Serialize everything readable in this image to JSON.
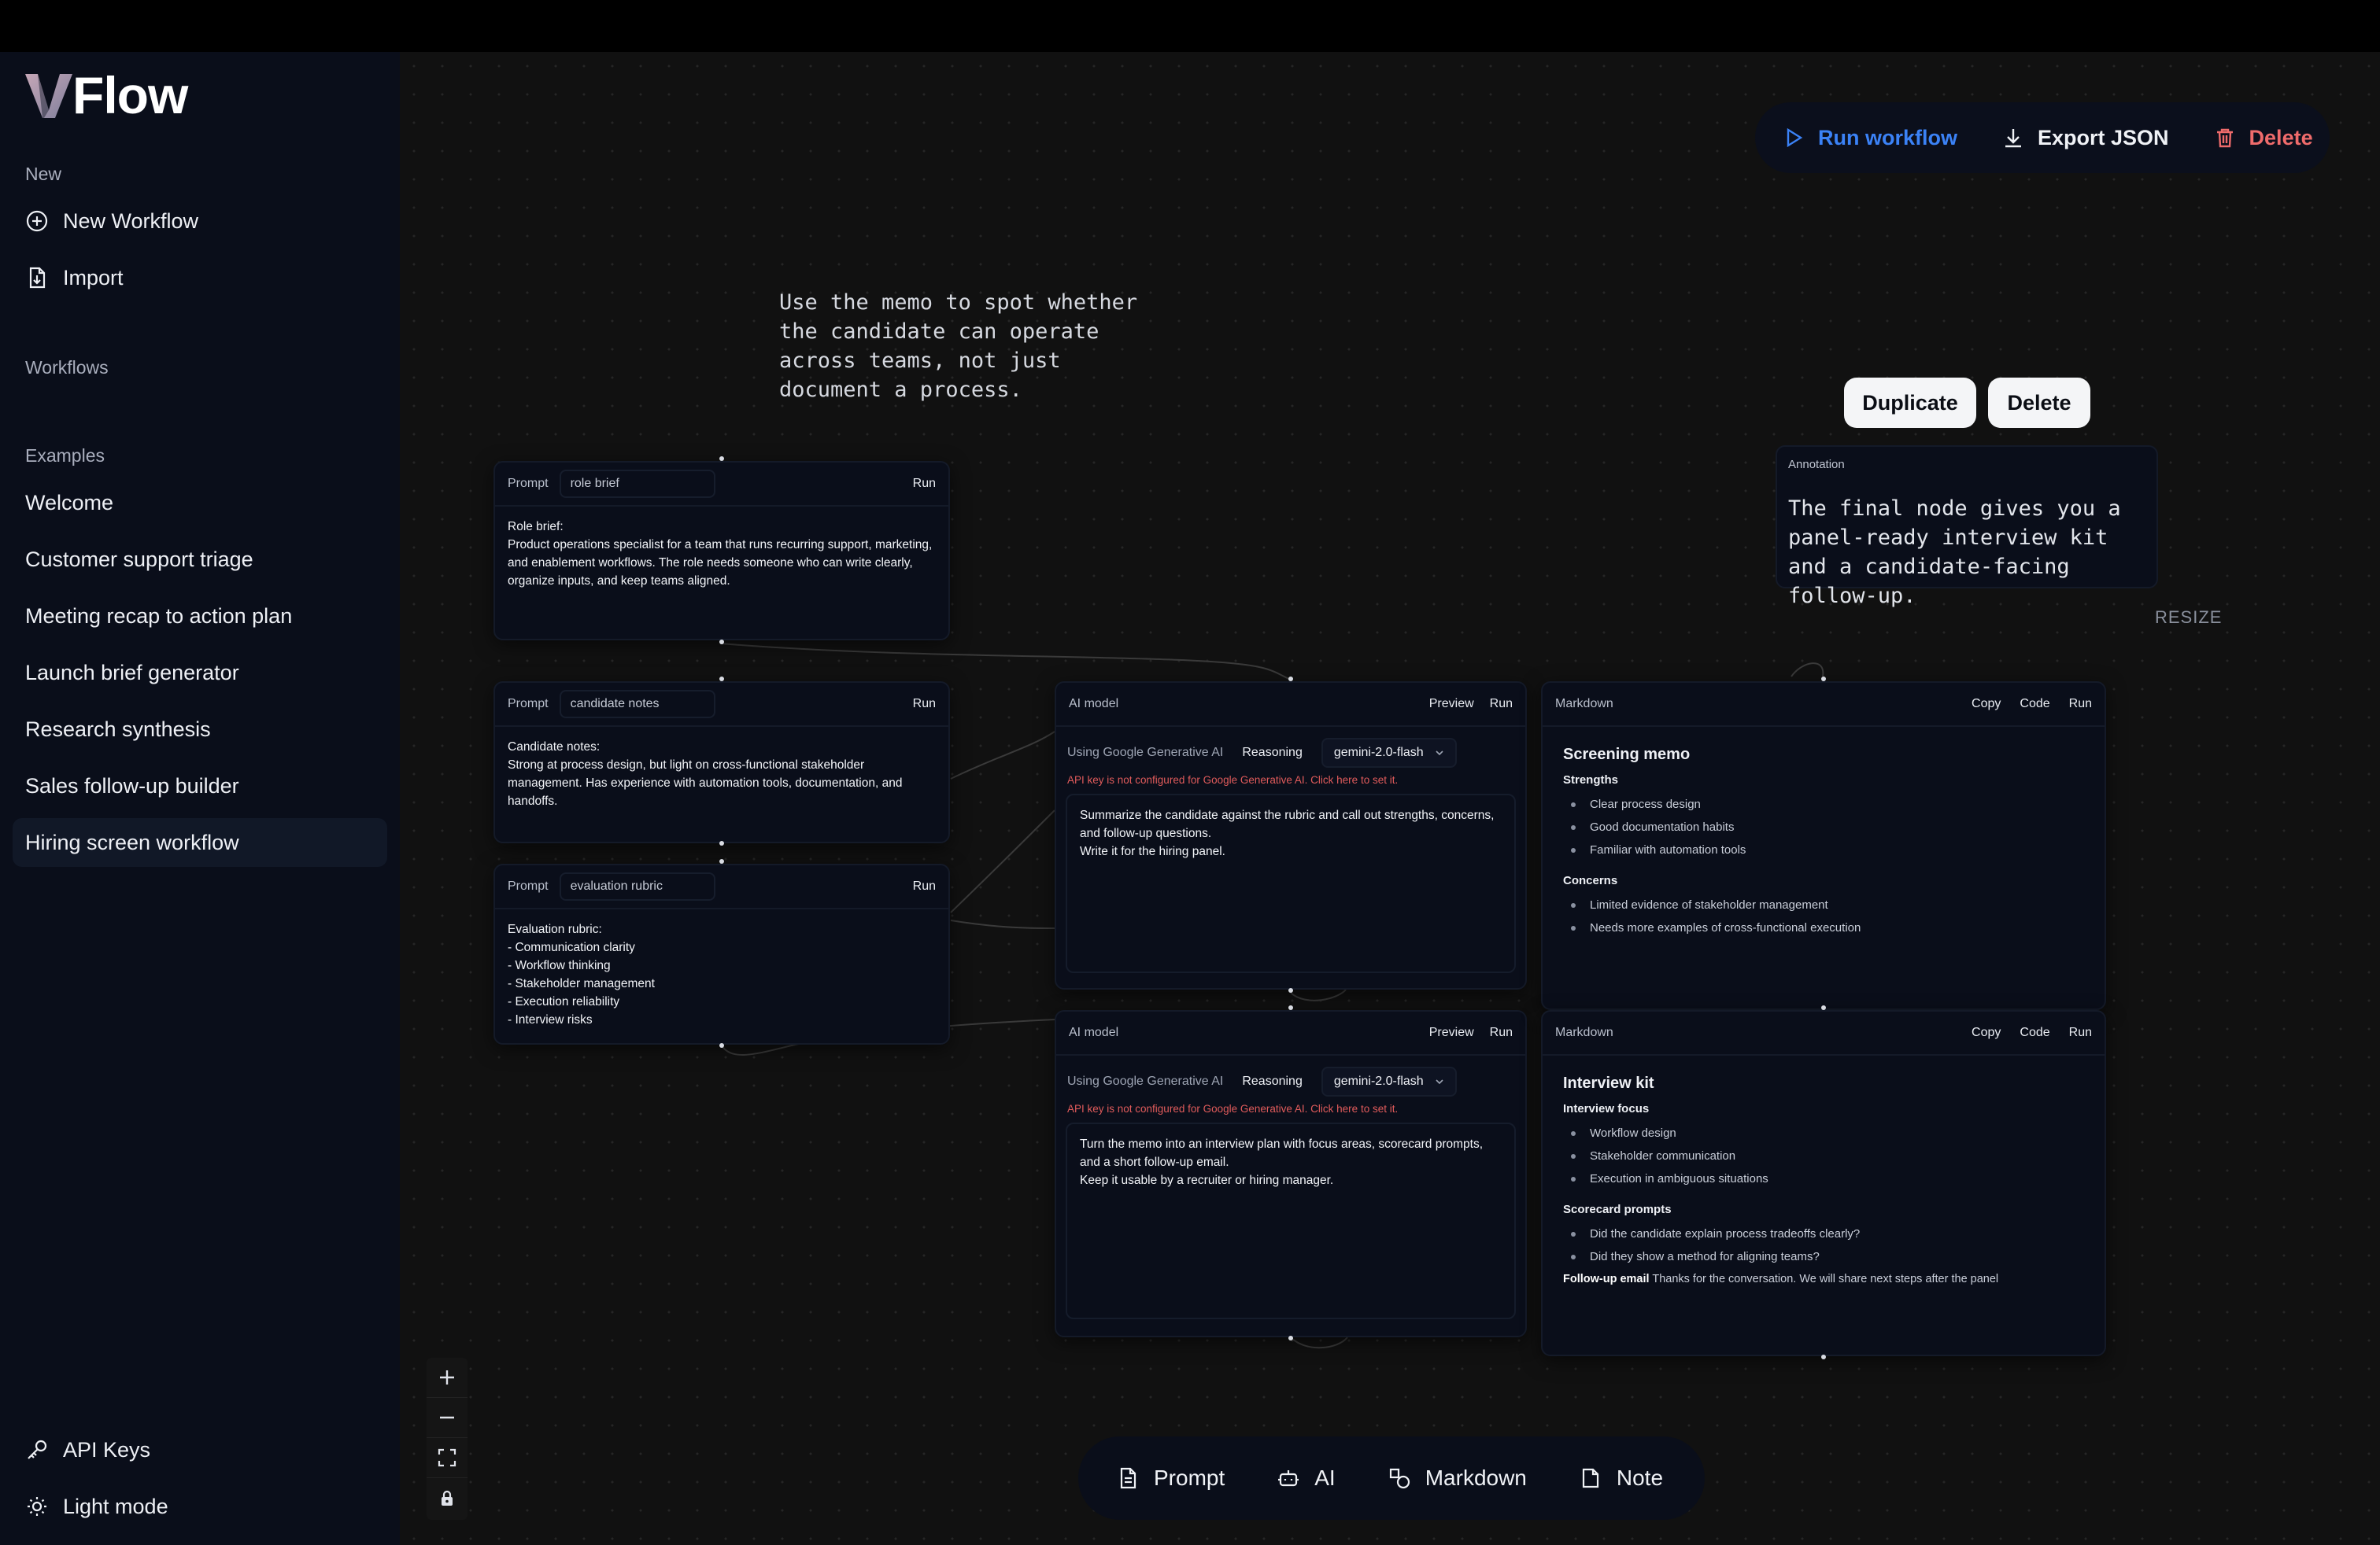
{
  "app": {
    "brand": "Flow"
  },
  "sidebar": {
    "new_heading": "New",
    "new_workflow": "New Workflow",
    "import": "Import",
    "workflows_heading": "Workflows",
    "examples_heading": "Examples",
    "examples": [
      "Welcome",
      "Customer support triage",
      "Meeting recap to action plan",
      "Launch brief generator",
      "Research synthesis",
      "Sales follow-up builder",
      "Hiring screen workflow"
    ],
    "active_example": "Hiring screen workflow",
    "api_keys": "API Keys",
    "light_mode": "Light mode"
  },
  "toolbar": {
    "run": "Run workflow",
    "export": "Export JSON",
    "delete": "Delete"
  },
  "sticky_note": "Use the memo to spot whether the candidate can operate across teams, not just document a process.",
  "selection_actions": {
    "duplicate": "Duplicate",
    "delete": "Delete"
  },
  "annotation": {
    "label": "Annotation",
    "text": "The final node gives you a panel-ready interview kit and a candidate-facing follow-up.",
    "resize": "RESIZE"
  },
  "prompt_nodes": [
    {
      "type": "Prompt",
      "name": "role brief",
      "run": "Run",
      "body": "Role brief:\nProduct operations specialist for a team that runs recurring support, marketing, and enablement workflows. The role needs someone who can write clearly, organize inputs, and keep teams aligned."
    },
    {
      "type": "Prompt",
      "name": "candidate notes",
      "run": "Run",
      "body": "Candidate notes:\nStrong at process design, but light on cross-functional stakeholder management. Has experience with automation tools, documentation, and handoffs."
    },
    {
      "type": "Prompt",
      "name": "evaluation rubric",
      "run": "Run",
      "body": "Evaluation rubric:\n- Communication clarity\n- Workflow thinking\n- Stakeholder management\n- Execution reliability\n- Interview risks"
    }
  ],
  "ai_nodes": [
    {
      "type": "AI model",
      "preview": "Preview",
      "run": "Run",
      "using": "Using Google Generative AI",
      "reasoning": "Reasoning",
      "model": "gemini-2.0-flash",
      "warning": "API key is not configured for Google Generative AI. Click here to set it.",
      "prompt": "Summarize the candidate against the rubric and call out strengths, concerns, and follow-up questions.\nWrite it for the hiring panel."
    },
    {
      "type": "AI model",
      "preview": "Preview",
      "run": "Run",
      "using": "Using Google Generative AI",
      "reasoning": "Reasoning",
      "model": "gemini-2.0-flash",
      "warning": "API key is not configured for Google Generative AI. Click here to set it.",
      "prompt": "Turn the memo into an interview plan with focus areas, scorecard prompts, and a short follow-up email.\nKeep it usable by a recruiter or hiring manager."
    }
  ],
  "markdown_nodes": [
    {
      "type": "Markdown",
      "copy": "Copy",
      "code": "Code",
      "run": "Run",
      "title": "Screening memo",
      "sections": [
        {
          "heading": "Strengths",
          "items": [
            "Clear process design",
            "Good documentation habits",
            "Familiar with automation tools"
          ]
        },
        {
          "heading": "Concerns",
          "items": [
            "Limited evidence of stakeholder management",
            "Needs more examples of cross-functional execution"
          ]
        }
      ]
    },
    {
      "type": "Markdown",
      "copy": "Copy",
      "code": "Code",
      "run": "Run",
      "title": "Interview kit",
      "sections": [
        {
          "heading": "Interview focus",
          "items": [
            "Workflow design",
            "Stakeholder communication",
            "Execution in ambiguous situations"
          ]
        },
        {
          "heading": "Scorecard prompts",
          "items": [
            "Did the candidate explain process tradeoffs clearly?",
            "Did they show a method for aligning teams?"
          ]
        }
      ],
      "footer_label": "Follow-up email",
      "footer_text": "Thanks for the conversation. We will share next steps after the panel"
    }
  ],
  "bottom_bar": {
    "prompt": "Prompt",
    "ai": "AI",
    "markdown": "Markdown",
    "note": "Note"
  },
  "colors": {
    "accent": "#3b82f6",
    "danger": "#ef6b6b",
    "warning": "#e05b5b",
    "canvas": "#111111",
    "panel": "#0a0e1a"
  }
}
